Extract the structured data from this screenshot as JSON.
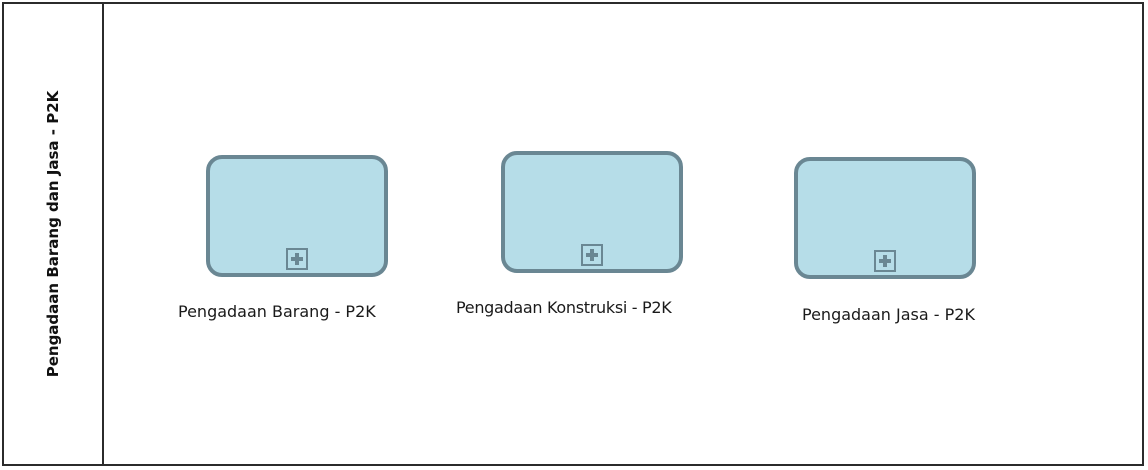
{
  "lane": {
    "title": "Pengadaan Barang dan Jasa - P2K"
  },
  "colors": {
    "task_fill": "#b6dde8",
    "task_border": "#6a8793",
    "pool_border": "#2b2b2b"
  },
  "tasks": [
    {
      "label": "Pengadaan Barang - P2K",
      "marker_icon": "collapsed-subprocess-plus-icon"
    },
    {
      "label": "Pengadaan Konstruksi - P2K",
      "marker_icon": "collapsed-subprocess-plus-icon"
    },
    {
      "label": "Pengadaan Jasa - P2K",
      "marker_icon": "collapsed-subprocess-plus-icon"
    }
  ]
}
